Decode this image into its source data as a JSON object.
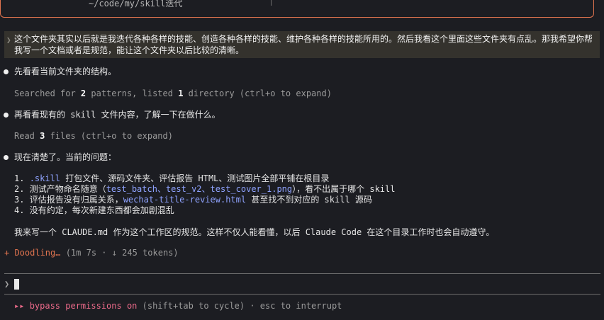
{
  "header": {
    "cwd": "~/code/my/skill迭代"
  },
  "user_message": {
    "caret": "❯",
    "text": "这个文件夹其实以后就是我迭代各种各样的技能、创造各种各样的技能、维护各种各样的技能所用的。然后我看这个里面这些文件夹有点乱。那我希望你帮我写一个文档或者是规范，能让这个文件夹以后比较的清晰。"
  },
  "step1": {
    "message": "先看看当前文件夹的结构。",
    "detail_prefix": "Searched for ",
    "patterns_count": "2",
    "detail_mid": " patterns, listed ",
    "dir_count": "1",
    "detail_suffix": " directory (ctrl+o to expand)"
  },
  "step2": {
    "message": "再看看现有的 skill 文件内容，了解一下在做什么。",
    "detail_prefix": "Read ",
    "files_count": "3",
    "detail_suffix": " files (ctrl+o to expand)"
  },
  "step3": {
    "message": "现在清楚了。当前的问题：",
    "items": [
      {
        "num": "1. ",
        "code": ".skill",
        "text": " 打包文件、源码文件夹、评估报告 HTML、测试图片全部平铺在根目录"
      },
      {
        "num": "2. ",
        "pre": "测试产物命名随意（",
        "code": "test_batch、test_v2、test_cover_1.png",
        "text": "），看不出属于哪个 skill"
      },
      {
        "num": "3. ",
        "pre": "评估报告没有归属关系，",
        "code": "wechat-title-review.html",
        "text": " 甚至找不到对应的 skill 源码"
      },
      {
        "num": "4. ",
        "text": "没有约定，每次新建东西都会加剧混乱"
      }
    ],
    "conclusion": "我来写一个 CLAUDE.md 作为这个工作区的规范。这样不仅人能看懂，以后 Claude Code 在这个目录工作时也会自动遵守。"
  },
  "progress": {
    "marker": "+ ",
    "label": "Doodling…",
    "detail": " (1m 7s · ↓ 245 tokens)"
  },
  "prompt": {
    "caret": "❯"
  },
  "status": {
    "arrows": "▸▸ ",
    "mode": "bypass permissions on",
    "hint": " (shift+tab to cycle) · esc to interrupt"
  },
  "colors": {
    "accent": "#e1744f",
    "code": "#8fa3ff",
    "permission": "#ec6a8a"
  }
}
